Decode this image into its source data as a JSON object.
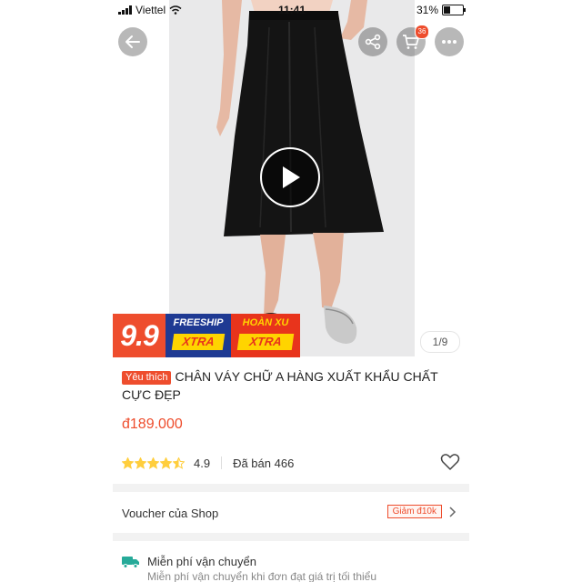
{
  "status_bar": {
    "carrier": "Viettel",
    "time": "11:41",
    "battery": "31%"
  },
  "nav": {
    "cart_count": "36"
  },
  "gallery": {
    "page_indicator": "1/9"
  },
  "promo": {
    "sale_label": "9.9",
    "freeship": "FREESHIP",
    "freeship_tag": "XTRA",
    "hoanxu": "HOÀN XU",
    "hoanxu_tag": "XTRA"
  },
  "product": {
    "badge": "Yêu thích",
    "title": "CHÂN VÁY CHỮ A HÀNG XUẤT KHẨU CHẤT CỰC ĐẸP",
    "price": "đ189.000",
    "rating": "4.9",
    "rating_stars": 4.5,
    "sold": "Đã bán 466"
  },
  "voucher": {
    "label": "Voucher của Shop",
    "tag": "Giảm đ10k"
  },
  "shipping": {
    "title": "Miễn phí vận chuyển",
    "subtitle": "Miễn phí vận chuyển khi đơn đạt giá trị tối thiểu"
  },
  "colors": {
    "accent": "#ee4d2d",
    "star": "#ffce3d"
  }
}
